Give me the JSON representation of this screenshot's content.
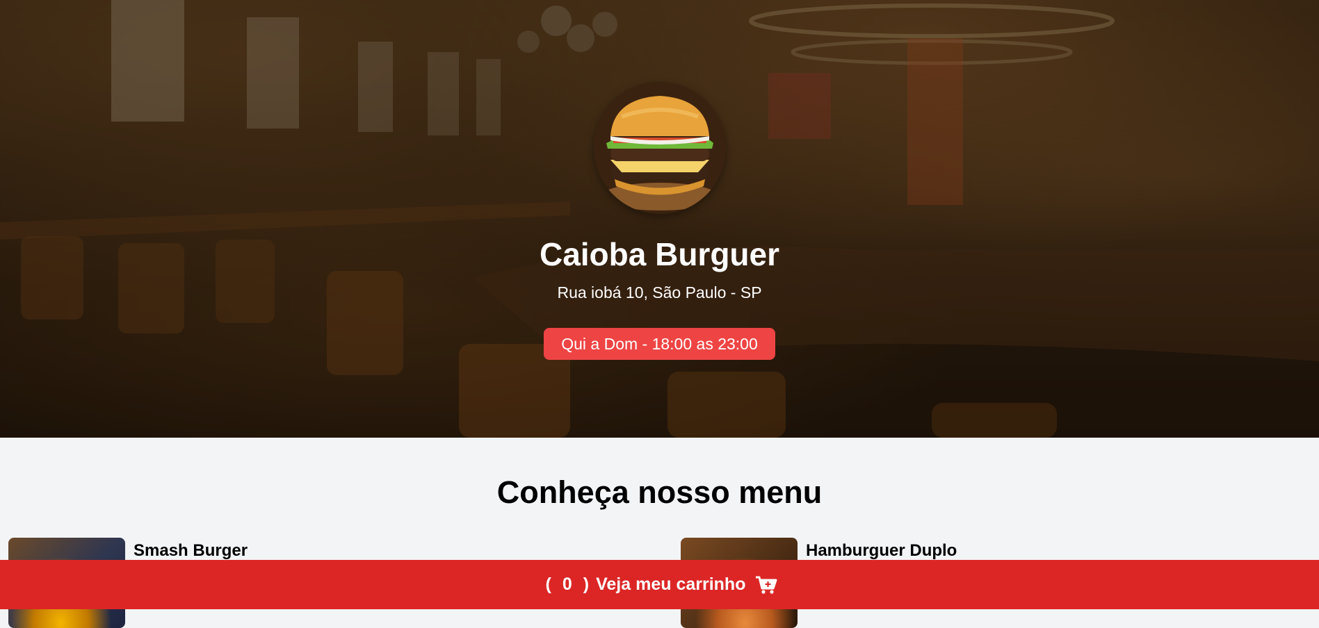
{
  "hero": {
    "name": "Caioba Burguer",
    "address": "Rua iobá 10, São Paulo - SP",
    "hours": "Qui a Dom - 18:00 as 23:00",
    "logo_icon": "burger-logo"
  },
  "menu": {
    "title": "Conheça nosso menu",
    "items": [
      {
        "name": "Smash Burger"
      },
      {
        "name": "Hamburguer Duplo"
      }
    ]
  },
  "cart": {
    "open_paren": "(",
    "count": "0",
    "close_paren": ")",
    "label": "Veja meu carrinho",
    "icon": "cart-plus-icon"
  },
  "colors": {
    "accent": "#ef4444",
    "cart_bar": "#dc2626",
    "page_bg": "#f3f4f6"
  }
}
